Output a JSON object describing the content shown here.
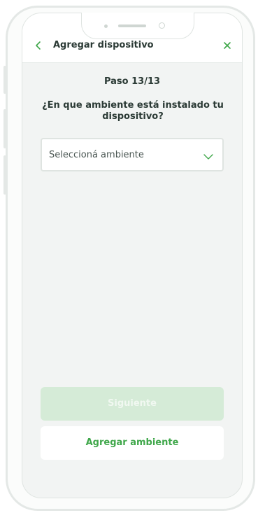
{
  "header": {
    "title": "Agregar dispositivo",
    "back_icon": "chevron-left-icon",
    "close_icon": "close-icon"
  },
  "main": {
    "step": "Paso 13/13",
    "question": "¿En que ambiente está instalado tu dispositivo?",
    "select": {
      "value": "Seleccioná ambiente",
      "icon": "chevron-down-icon"
    }
  },
  "footer": {
    "next_label": "Siguiente",
    "add_label": "Agregar  ambiente"
  },
  "colors": {
    "accent": "#3fa74a",
    "accent_disabled": "#d5ebd7",
    "text": "#2b3a35",
    "background": "#f2f4f3"
  }
}
